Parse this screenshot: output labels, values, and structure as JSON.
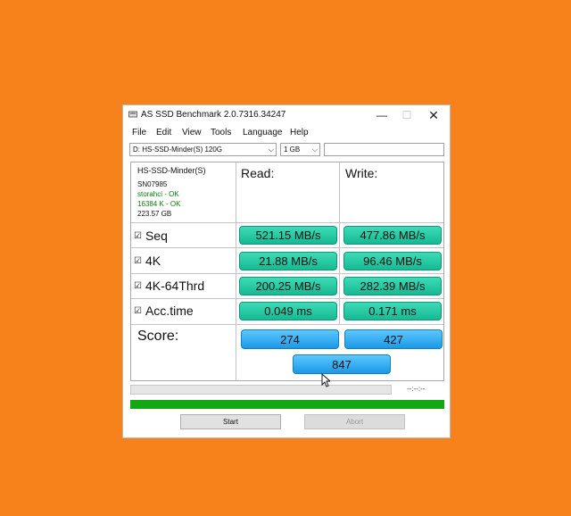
{
  "window": {
    "title": "AS SSD Benchmark 2.0.7316.34247",
    "min_glyph": "—",
    "max_glyph": "☐",
    "close_glyph": "✕"
  },
  "menu": [
    "File",
    "Edit",
    "View",
    "Tools",
    "Language",
    "Help"
  ],
  "toolbar": {
    "drive": "D: HS-SSD-Minder(S) 120G",
    "size": "1 GB",
    "search_value": ""
  },
  "drive_info": {
    "name": "HS-SSD-Minder(S)",
    "serial": "SN07985",
    "driver": "storahci - OK",
    "alignment": "16384 K - OK",
    "capacity": "223.57 GB"
  },
  "headers": {
    "read": "Read:",
    "write": "Write:"
  },
  "rows": [
    {
      "label": "Seq",
      "checked": "☑",
      "read": "521.15 MB/s",
      "write": "477.86 MB/s"
    },
    {
      "label": "4K",
      "checked": "☑",
      "read": "21.88 MB/s",
      "write": "96.46 MB/s"
    },
    {
      "label": "4K-64Thrd",
      "checked": "☑",
      "read": "200.25 MB/s",
      "write": "282.39 MB/s"
    },
    {
      "label": "Acc.time",
      "checked": "☑",
      "read": "0.049 ms",
      "write": "0.171 ms"
    }
  ],
  "score": {
    "label": "Score:",
    "read": "274",
    "write": "427",
    "total": "847"
  },
  "status": {
    "time": "--:--:--",
    "progress": 0
  },
  "buttons": {
    "start": "Start",
    "abort": "Abort"
  },
  "icons": {
    "chevron": "chevron-down-icon",
    "app": "drive-icon",
    "cursor": "mouse-cursor-icon"
  },
  "colors": {
    "background": "#f7821b",
    "result_green": "#1ec9a0",
    "score_blue": "#2aa9f2",
    "progress_green": "#14a714"
  }
}
